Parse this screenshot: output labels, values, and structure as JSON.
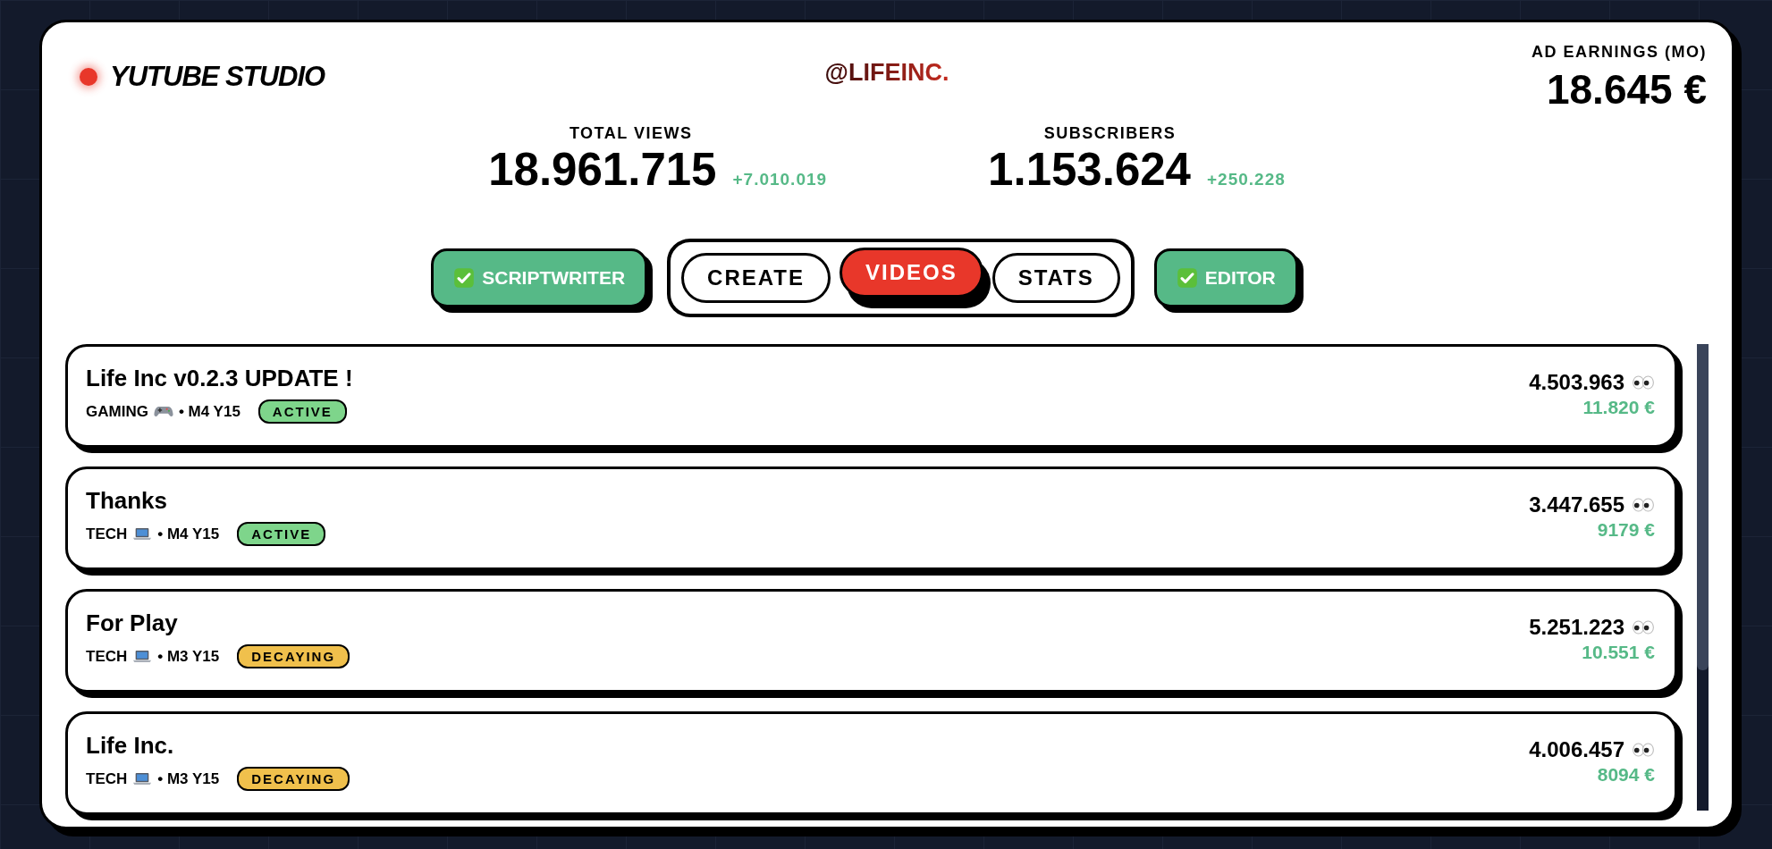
{
  "app": {
    "title": "YUTUBE STUDIO",
    "channel": "@LIFEINC."
  },
  "earnings": {
    "label": "AD EARNINGS (MO)",
    "value": "18.645 €"
  },
  "stats": [
    {
      "label": "TOTAL VIEWS",
      "value": "18.961.715",
      "delta": "+7.010.019"
    },
    {
      "label": "SUBSCRIBERS",
      "value": "1.153.624",
      "delta": "+250.228"
    }
  ],
  "team": [
    {
      "label": "SCRIPTWRITER",
      "checked": true
    },
    {
      "label": "EDITOR",
      "checked": true
    }
  ],
  "tabs": [
    {
      "label": "CREATE",
      "selected": false
    },
    {
      "label": "VIDEOS",
      "selected": true
    },
    {
      "label": "STATS",
      "selected": false
    }
  ],
  "videos": [
    {
      "title": "Life Inc v0.2.3 UPDATE !",
      "category": "GAMING",
      "kind": "gamepad",
      "date": "• M4 Y15",
      "status": "ACTIVE",
      "color": "#7ed58b",
      "views": "4.503.963",
      "revenue": "11.820 €"
    },
    {
      "title": "Thanks",
      "category": "TECH",
      "kind": "laptop",
      "date": "• M4 Y15",
      "status": "ACTIVE",
      "color": "#7ed58b",
      "views": "3.447.655",
      "revenue": "9179 €"
    },
    {
      "title": "For Play",
      "category": "TECH",
      "kind": "laptop",
      "date": "• M3 Y15",
      "status": "DECAYING",
      "color": "#f0c04c",
      "views": "5.251.223",
      "revenue": "10.551 €"
    },
    {
      "title": "Life Inc.",
      "category": "TECH",
      "kind": "laptop",
      "date": "• M3 Y15",
      "status": "DECAYING",
      "color": "#f0c04c",
      "views": "4.006.457",
      "revenue": "8094 €"
    }
  ]
}
